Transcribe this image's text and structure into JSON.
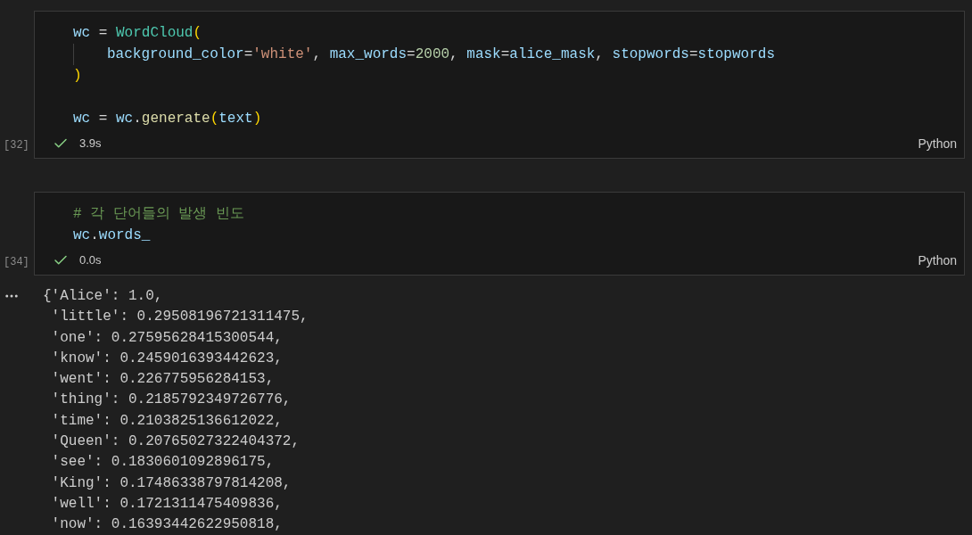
{
  "cells": [
    {
      "execution_count": "[32]",
      "status": "3.9s",
      "succeeded": true,
      "language": "Python",
      "lines": [
        {
          "kind": "code",
          "indented": false,
          "tokens": [
            {
              "kind": "var",
              "text": "wc"
            },
            {
              "kind": "plain",
              "text": " = "
            },
            {
              "kind": "class",
              "text": "WordCloud"
            },
            {
              "kind": "paren",
              "text": "("
            }
          ]
        },
        {
          "kind": "code",
          "indented": true,
          "tokens": [
            {
              "kind": "var",
              "text": "background_color"
            },
            {
              "kind": "plain",
              "text": "="
            },
            {
              "kind": "str",
              "text": "'white'"
            },
            {
              "kind": "plain",
              "text": ", "
            },
            {
              "kind": "var",
              "text": "max_words"
            },
            {
              "kind": "plain",
              "text": "="
            },
            {
              "kind": "num",
              "text": "2000"
            },
            {
              "kind": "plain",
              "text": ", "
            },
            {
              "kind": "var",
              "text": "mask"
            },
            {
              "kind": "plain",
              "text": "="
            },
            {
              "kind": "var",
              "text": "alice_mask"
            },
            {
              "kind": "plain",
              "text": ", "
            },
            {
              "kind": "var",
              "text": "stopwords"
            },
            {
              "kind": "plain",
              "text": "="
            },
            {
              "kind": "var",
              "text": "stopwords"
            }
          ]
        },
        {
          "kind": "code",
          "indented": false,
          "tokens": [
            {
              "kind": "paren",
              "text": ")"
            }
          ]
        },
        {
          "kind": "blank"
        },
        {
          "kind": "code",
          "indented": false,
          "tokens": [
            {
              "kind": "var",
              "text": "wc"
            },
            {
              "kind": "plain",
              "text": " = "
            },
            {
              "kind": "var",
              "text": "wc"
            },
            {
              "kind": "plain",
              "text": "."
            },
            {
              "kind": "method",
              "text": "generate"
            },
            {
              "kind": "paren",
              "text": "("
            },
            {
              "kind": "var",
              "text": "text"
            },
            {
              "kind": "paren",
              "text": ")"
            }
          ]
        }
      ]
    },
    {
      "execution_count": "[34]",
      "status": "0.0s",
      "succeeded": true,
      "language": "Python",
      "lines": [
        {
          "kind": "code",
          "indented": false,
          "tokens": [
            {
              "kind": "comment",
              "text": "# 각 단어들의 발생 빈도"
            }
          ]
        },
        {
          "kind": "code",
          "indented": false,
          "tokens": [
            {
              "kind": "var",
              "text": "wc"
            },
            {
              "kind": "plain",
              "text": "."
            },
            {
              "kind": "var",
              "text": "words_"
            }
          ]
        }
      ],
      "output": [
        "{'Alice': 1.0,",
        " 'little': 0.29508196721311475,",
        " 'one': 0.27595628415300544,",
        " 'know': 0.2459016393442623,",
        " 'went': 0.226775956284153,",
        " 'thing': 0.2185792349726776,",
        " 'time': 0.2103825136612022,",
        " 'Queen': 0.20765027322404372,",
        " 'see': 0.1830601092896175,",
        " 'King': 0.17486338797814208,",
        " 'well': 0.1721311475409836,",
        " 'now': 0.16393442622950818,"
      ]
    }
  ]
}
